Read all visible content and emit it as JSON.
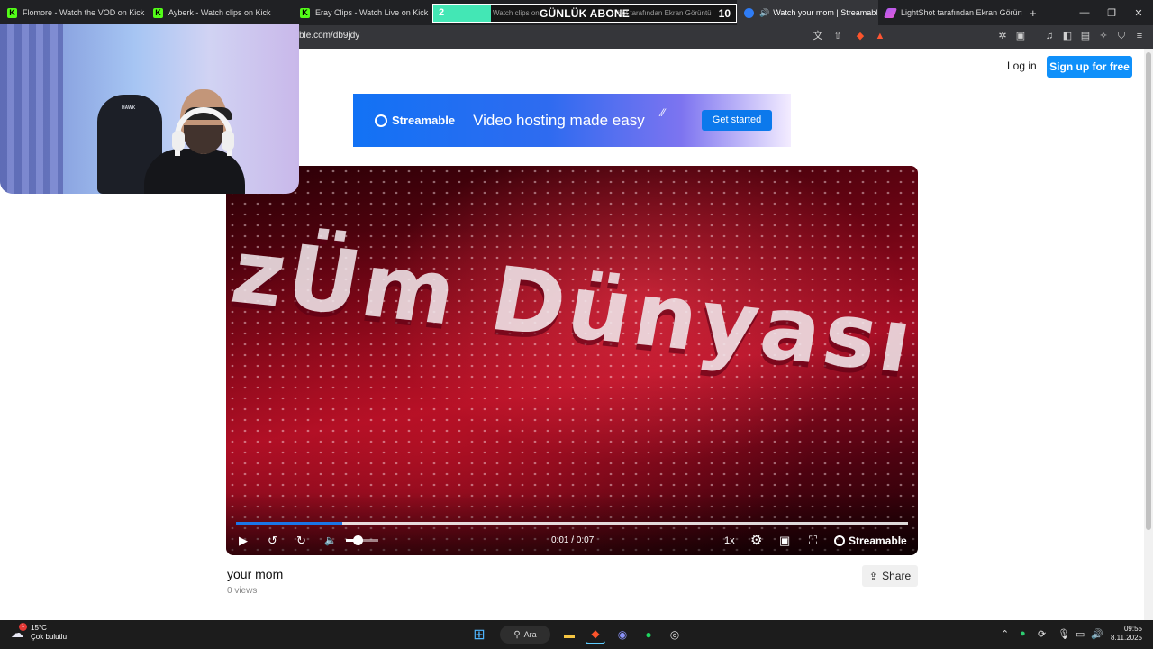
{
  "browser": {
    "tabs": [
      {
        "label": "Flomore - Watch the VOD on Kick",
        "icon": "kick-icon"
      },
      {
        "label": "Ayberk - Watch clips on Kick",
        "icon": "kick-icon"
      },
      {
        "label": "Eray Clips - Watch Live on Kick",
        "icon": "kick-icon"
      },
      {
        "label": "Watch clips on",
        "icon": "kick-icon"
      },
      {
        "label": "Watch your mom | Streamabl",
        "icon": "streamable-icon",
        "active": true
      },
      {
        "label": "LightShot tarafından Ekran Görüntü",
        "icon": "lightshot-icon"
      }
    ],
    "new_tab": "+",
    "url": "ble.com/db9jdy",
    "window_controls": {
      "minimize": "—",
      "restore": "❐",
      "close": "✕"
    }
  },
  "subscriber_widget": {
    "count_left": "2",
    "label": "GÜNLÜK ABONE",
    "count_right": "10",
    "under_text_a": "Watch clips on",
    "under_text_b": "hot tarafından Ekran Görüntü"
  },
  "header": {
    "login": "Log in",
    "signup": "Sign up for free"
  },
  "banner": {
    "brand": "Streamable",
    "tagline": "Video hosting made easy",
    "cta": "Get started"
  },
  "video": {
    "overlay_text": "zÜm Dünyası",
    "current_time": "0:01",
    "duration": "0:07",
    "time_display": "0:01 / 0:07",
    "progress_fraction": 0.158,
    "volume_fraction": 0.35,
    "speed": "1x",
    "brand": "Streamable",
    "title": "your mom",
    "views": "0 views",
    "share": "Share"
  },
  "webcam": {
    "chair_logo": "HAWK"
  },
  "taskbar": {
    "weather_temp": "15°C",
    "weather_cond": "Çok bulutlu",
    "weather_badge": "1",
    "search": "Ara",
    "time": "09:55",
    "date": "8.11.2025"
  },
  "colors": {
    "accent": "#0f90fa",
    "kick": "#53fc18",
    "progress": "#1b76e8",
    "widget_green": "#43e7b5"
  }
}
